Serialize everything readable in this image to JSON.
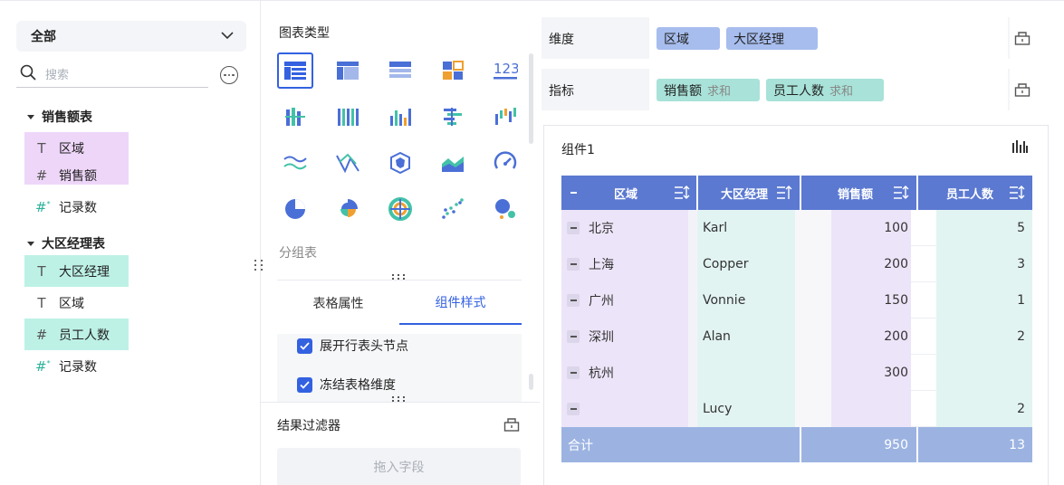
{
  "left_panel": {
    "scope_select": "全部",
    "search_placeholder": "搜索",
    "groups": [
      {
        "name": "销售额表",
        "fields": [
          {
            "type": "T",
            "label": "区域",
            "state": "dimension-used"
          },
          {
            "type": "#",
            "label": "销售额",
            "state": "dimension-used"
          },
          {
            "type": "#*",
            "label": "记录数",
            "state": "normal"
          }
        ]
      },
      {
        "name": "大区经理表",
        "fields": [
          {
            "type": "T",
            "label": "大区经理",
            "state": "measure-used"
          },
          {
            "type": "T",
            "label": "区域",
            "state": "normal"
          },
          {
            "type": "#",
            "label": "员工人数",
            "state": "measure-used"
          },
          {
            "type": "#*",
            "label": "记录数",
            "state": "normal"
          }
        ]
      }
    ]
  },
  "middle_panel": {
    "chart_type_title": "图表类型",
    "chart_types": [
      "group-table",
      "cross-table",
      "detail-table",
      "kpi-block",
      "number",
      "bar",
      "stacked-column",
      "column",
      "horizontal-bar",
      "waterfall",
      "line",
      "radar",
      "polygon",
      "area",
      "gauge",
      "pie",
      "rose",
      "sunburst",
      "scatter",
      "bubble"
    ],
    "selected_chart_type": "group-table",
    "selected_type_label": "分组表",
    "tabs": [
      "表格属性",
      "组件样式"
    ],
    "active_tab": "组件样式",
    "options": [
      {
        "label": "展开行表头节点",
        "checked": true
      },
      {
        "label": "冻结表格维度",
        "checked": true
      }
    ],
    "result_filter_title": "结果过滤器",
    "drop_placeholder": "拖入字段"
  },
  "right_panel": {
    "dimension_shelf": {
      "label": "维度",
      "pills": [
        "区域",
        "大区经理"
      ]
    },
    "metric_shelf": {
      "label": "指标",
      "pills": [
        {
          "name": "销售额",
          "agg": "求和"
        },
        {
          "name": "员工人数",
          "agg": "求和"
        }
      ]
    },
    "component_title": "组件1",
    "table": {
      "headers": [
        "区域",
        "大区经理",
        "销售额",
        "员工人数"
      ],
      "rows": [
        {
          "region": "北京",
          "manager": "Karl",
          "sales": "100",
          "staff": "5"
        },
        {
          "region": "上海",
          "manager": "Copper",
          "sales": "200",
          "staff": "3"
        },
        {
          "region": "广州",
          "manager": "Vonnie",
          "sales": "150",
          "staff": "1"
        },
        {
          "region": "深圳",
          "manager": "Alan",
          "sales": "200",
          "staff": "2"
        },
        {
          "region": "杭州",
          "manager": "",
          "sales": "300",
          "staff": ""
        },
        {
          "region": "",
          "manager": "Lucy",
          "sales": "",
          "staff": "2"
        }
      ],
      "total": {
        "label": "合计",
        "sales": "950",
        "staff": "13"
      }
    }
  },
  "colors": {
    "accent": "#3361e0",
    "header_bg": "#5b79d1",
    "total_bg": "#9cb3e2",
    "dimension_pill": "#a7bdee",
    "metric_pill": "#a8e2d8",
    "dimension_field": "#eed6f9",
    "metric_field": "#bdf1e6"
  }
}
